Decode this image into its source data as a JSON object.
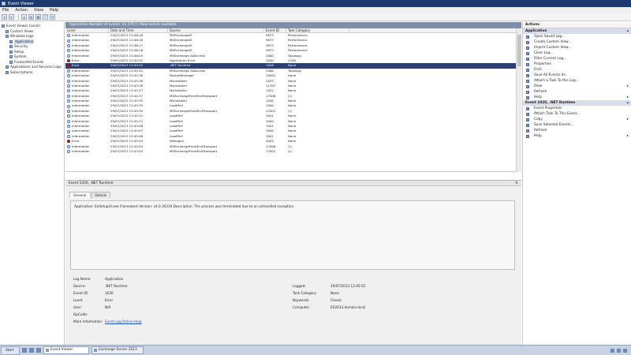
{
  "window": {
    "title": "Event Viewer"
  },
  "menu": [
    "File",
    "Action",
    "View",
    "Help"
  ],
  "toolbar_icons": [
    "back-icon",
    "forward-icon",
    "up-icon",
    "show-hide-tree-icon",
    "properties-icon",
    "help-icon",
    "refresh-icon"
  ],
  "tree": {
    "items": [
      {
        "label": "Event Viewer (Local)",
        "indent": 0
      },
      {
        "label": "Custom Views",
        "indent": 1
      },
      {
        "label": "Windows Logs",
        "indent": 1
      },
      {
        "label": "Application",
        "indent": 2,
        "selected": true
      },
      {
        "label": "Security",
        "indent": 2
      },
      {
        "label": "Setup",
        "indent": 2
      },
      {
        "label": "System",
        "indent": 2
      },
      {
        "label": "Forwarded Events",
        "indent": 2
      },
      {
        "label": "Applications and Services Logs",
        "indent": 1
      },
      {
        "label": "Subscriptions",
        "indent": 1
      }
    ]
  },
  "list": {
    "header": "Application   Number of events: 41,579 (!) New events available",
    "columns": [
      "Level",
      "Date and Time",
      "Source",
      "Event ID",
      "Task Category"
    ],
    "rows": [
      {
        "level": "Information",
        "type": "info",
        "date": "29/07/2013 13:46:18",
        "source": "MSExchangeIS",
        "id": "9873",
        "cat": "Performance"
      },
      {
        "level": "Information",
        "type": "info",
        "date": "29/07/2013 13:46:18",
        "source": "MSExchangeIS",
        "id": "9873",
        "cat": "Performance"
      },
      {
        "level": "Information",
        "type": "info",
        "date": "29/07/2013 13:46:17",
        "source": "MSExchangeIS",
        "id": "9873",
        "cat": "Performance"
      },
      {
        "level": "Information",
        "type": "info",
        "date": "29/07/2013 13:46:16",
        "source": "MSExchangeIS",
        "id": "9873",
        "cat": "Performance"
      },
      {
        "level": "Information",
        "type": "info",
        "date": "29/07/2013 13:46:05",
        "source": "MSExchange ADAccess",
        "id": "2080",
        "cat": "Topology"
      },
      {
        "level": "Error",
        "type": "error",
        "date": "29/07/2013 13:45:52",
        "source": "Application Error",
        "id": "1000",
        "cat": "(100)"
      },
      {
        "level": "Error",
        "type": "error",
        "date": "29/07/2013 13:45:52",
        "source": ".NET Runtime",
        "id": "1026",
        "cat": "None",
        "selected": true
      },
      {
        "level": "Information",
        "type": "info",
        "date": "29/07/2013 13:45:42",
        "source": "MSExchange ADAccess",
        "id": "2080",
        "cat": "Topology"
      },
      {
        "level": "Information",
        "type": "info",
        "date": "29/07/2013 13:45:38",
        "source": "RestartManager",
        "id": "10001",
        "cat": "None"
      },
      {
        "level": "Information",
        "type": "info",
        "date": "29/07/2013 13:45:38",
        "source": "MsiInstaller",
        "id": "1033",
        "cat": "None"
      },
      {
        "level": "Information",
        "type": "info",
        "date": "29/07/2013 13:45:38",
        "source": "MsiInstaller",
        "id": "11707",
        "cat": "None"
      },
      {
        "level": "Information",
        "type": "info",
        "date": "29/07/2013 13:45:37",
        "source": "MsiInstaller",
        "id": "1022",
        "cat": "None"
      },
      {
        "level": "Information",
        "type": "info",
        "date": "29/07/2013 13:45:37",
        "source": "MSExchangeFrontEndTransport",
        "id": "17006",
        "cat": "(1)"
      },
      {
        "level": "Information",
        "type": "info",
        "date": "29/07/2013 13:45:35",
        "source": "MsiInstaller",
        "id": "1040",
        "cat": "None"
      },
      {
        "level": "Information",
        "type": "info",
        "date": "29/07/2013 13:45:35",
        "source": "LoadPerf",
        "id": "1000",
        "cat": "None"
      },
      {
        "level": "Information",
        "type": "info",
        "date": "29/07/2013 13:45:35",
        "source": "MSExchangeFrontEndTransport",
        "id": "17001",
        "cat": "(1)"
      },
      {
        "level": "Information",
        "type": "info",
        "date": "29/07/2013 13:45:12",
        "source": "LoadPerf",
        "id": "1001",
        "cat": "None"
      },
      {
        "level": "Information",
        "type": "info",
        "date": "29/07/2013 13:45:12",
        "source": "LoadPerf",
        "id": "1000",
        "cat": "None"
      },
      {
        "level": "Information",
        "type": "info",
        "date": "29/07/2013 13:45:08",
        "source": "LoadPerf",
        "id": "1001",
        "cat": "None"
      },
      {
        "level": "Information",
        "type": "info",
        "date": "29/07/2013 13:45:07",
        "source": "LoadPerf",
        "id": "1000",
        "cat": "None"
      },
      {
        "level": "Information",
        "type": "info",
        "date": "29/07/2013 13:45:06",
        "source": "LoadPerf",
        "id": "1001",
        "cat": "None"
      },
      {
        "level": "Error",
        "type": "error",
        "date": "29/07/2013 13:45:04",
        "source": "Winlogon",
        "id": "4005",
        "cat": "None"
      },
      {
        "level": "Information",
        "type": "info",
        "date": "29/07/2013 13:45:04",
        "source": "MSExchangeFrontEndTransport",
        "id": "17006",
        "cat": "(1)"
      },
      {
        "level": "Information",
        "type": "info",
        "date": "29/07/2013 13:45:03",
        "source": "MSExchangeFrontEndTransport",
        "id": "17001",
        "cat": "(1)"
      }
    ]
  },
  "detail": {
    "header": "Event 1026, .NET Runtime",
    "tabs": [
      "General",
      "Details"
    ],
    "message": "Application: ExSetupUI.exe Framework Version: v4.0.30319 Description: The process was terminated due to an unhandled exception.",
    "props_left": [
      {
        "k": "Log Name:",
        "v": "Application"
      },
      {
        "k": "Source:",
        "v": ".NET Runtime"
      },
      {
        "k": "Event ID:",
        "v": "1026"
      },
      {
        "k": "Level:",
        "v": "Error"
      },
      {
        "k": "User:",
        "v": "N/A"
      },
      {
        "k": "OpCode:",
        "v": ""
      }
    ],
    "more_info_label": "More Information:",
    "more_info_link": "Event Log Online Help",
    "props_right": [
      {
        "k": "Logged:",
        "v": "29/07/2013 13:45:52"
      },
      {
        "k": "Task Category:",
        "v": "None"
      },
      {
        "k": "Keywords:",
        "v": "Classic"
      },
      {
        "k": "Computer:",
        "v": "EX2013.domain.local"
      }
    ]
  },
  "actions": {
    "title": "Actions",
    "section1": "Application",
    "items1": [
      {
        "label": "Open Saved Log...",
        "sub": false
      },
      {
        "label": "Create Custom View...",
        "sub": false
      },
      {
        "label": "Import Custom View...",
        "sub": false
      },
      {
        "label": "Clear Log...",
        "sub": false
      },
      {
        "label": "Filter Current Log...",
        "sub": false
      },
      {
        "label": "Properties",
        "sub": false
      },
      {
        "label": "Find...",
        "sub": false
      },
      {
        "label": "Save All Events As...",
        "sub": false
      },
      {
        "label": "Attach a Task To this Log...",
        "sub": false
      },
      {
        "label": "View",
        "sub": true
      },
      {
        "label": "Refresh",
        "sub": false
      },
      {
        "label": "Help",
        "sub": true
      }
    ],
    "section2": "Event 1026, .NET Runtime",
    "items2": [
      {
        "label": "Event Properties",
        "sub": false
      },
      {
        "label": "Attach Task To This Event...",
        "sub": false
      },
      {
        "label": "Copy",
        "sub": true
      },
      {
        "label": "Save Selected Events...",
        "sub": false
      },
      {
        "label": "Refresh",
        "sub": false
      },
      {
        "label": "Help",
        "sub": true
      }
    ]
  },
  "taskbar": {
    "start": "Start",
    "buttons": [
      {
        "label": "Event Viewer",
        "active": true
      },
      {
        "label": "Exchange Server 2013",
        "active": false
      }
    ]
  }
}
